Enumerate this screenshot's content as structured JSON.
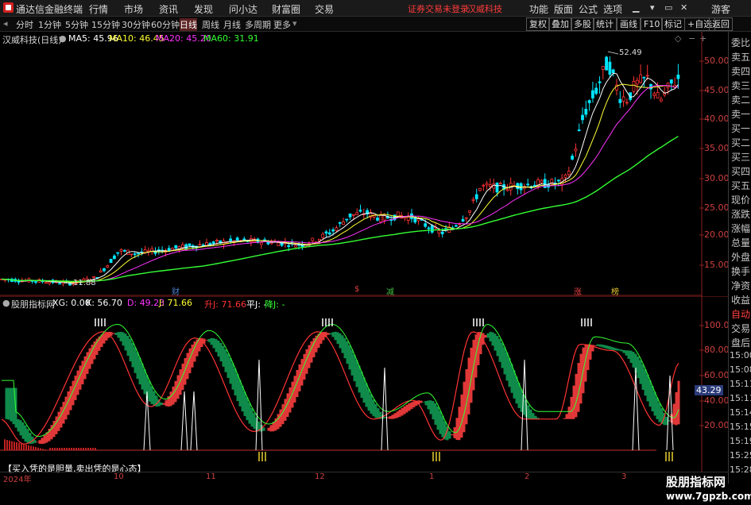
{
  "app": {
    "title": "通达信金融终端",
    "menu": [
      "行情",
      "市场",
      "资讯",
      "发现",
      "问小达",
      "财富圈",
      "交易"
    ],
    "notice": "证券交易未登录",
    "stock_name_top": "汉威科技",
    "right_menu": [
      "功能",
      "版面",
      "公式",
      "选项"
    ],
    "guest": "游客"
  },
  "periods": {
    "items": [
      "分时",
      "1分钟",
      "5分钟",
      "15分钟",
      "30分钟",
      "60分钟",
      "日线",
      "周线",
      "月线",
      "多周期",
      "更多"
    ],
    "selected": "日线",
    "tools": [
      "复权",
      "叠加",
      "多股",
      "统计",
      "画线",
      "F10",
      "标记",
      "+自选",
      "返回"
    ]
  },
  "main_chart": {
    "stock_label": "汉威科技(日线)",
    "ma": [
      {
        "label": "MA5: 45.96",
        "color": "#ffffff"
      },
      {
        "label": "MA10: 46.45",
        "color": "#ffff33"
      },
      {
        "label": "MA20: 45.20",
        "color": "#ff33ff"
      },
      {
        "label": "MA60: 31.91",
        "color": "#33ff33"
      }
    ],
    "high_label": "52.49",
    "low_label": "11.88",
    "y_ticks": [
      "50.00",
      "45.00",
      "40.00",
      "35.00",
      "30.00",
      "25.00",
      "20.00",
      "15.00"
    ],
    "markers": [
      {
        "text": "财",
        "color": "#4a7fd0"
      },
      {
        "text": "$",
        "color": "#e04040"
      },
      {
        "text": "减",
        "color": "#40c040"
      },
      {
        "text": "涨",
        "color": "#e04040"
      },
      {
        "text": "榜",
        "color": "#e0c030"
      }
    ]
  },
  "indicator": {
    "name": "股朋指标网",
    "items": [
      {
        "label": "XG: 0.00",
        "color": "#ffffff"
      },
      {
        "label": "K: 56.70",
        "color": "#ffffff"
      },
      {
        "label": "D: 49.23",
        "color": "#ff33ff"
      },
      {
        "label": "J: 71.66",
        "color": "#ffff33"
      },
      {
        "label": "升J: 71.66",
        "color": "#ff3333"
      },
      {
        "label": "平J: -",
        "color": "#ffffff"
      },
      {
        "label": "降J: -",
        "color": "#33ff33"
      }
    ],
    "y_ticks": [
      "100.00",
      "80.00",
      "60.00",
      "40.00",
      "20.00"
    ],
    "current_value": "43.29",
    "caption": "【买入凭的是胆量,卖出凭的是心态】"
  },
  "right_panel": {
    "items": [
      "委比",
      "卖五",
      "卖四",
      "卖三",
      "卖二",
      "卖一",
      "买一",
      "买二",
      "买三",
      "买四",
      "买五",
      "现价",
      "涨跌",
      "涨幅",
      "总量",
      "外盘",
      "换手",
      "净资",
      "收益",
      "自动",
      "交易",
      "盘后",
      "15:00",
      "15:08",
      "15:11",
      "15:11",
      "15:14",
      "15:15",
      "15:19",
      "15:25",
      "15:28"
    ]
  },
  "x_axis": {
    "labels": [
      "2024年",
      "10",
      "11",
      "12",
      "1",
      "2",
      "3"
    ]
  },
  "watermark": {
    "title": "股朋指标网",
    "url": "www.7gpzb.com"
  }
}
